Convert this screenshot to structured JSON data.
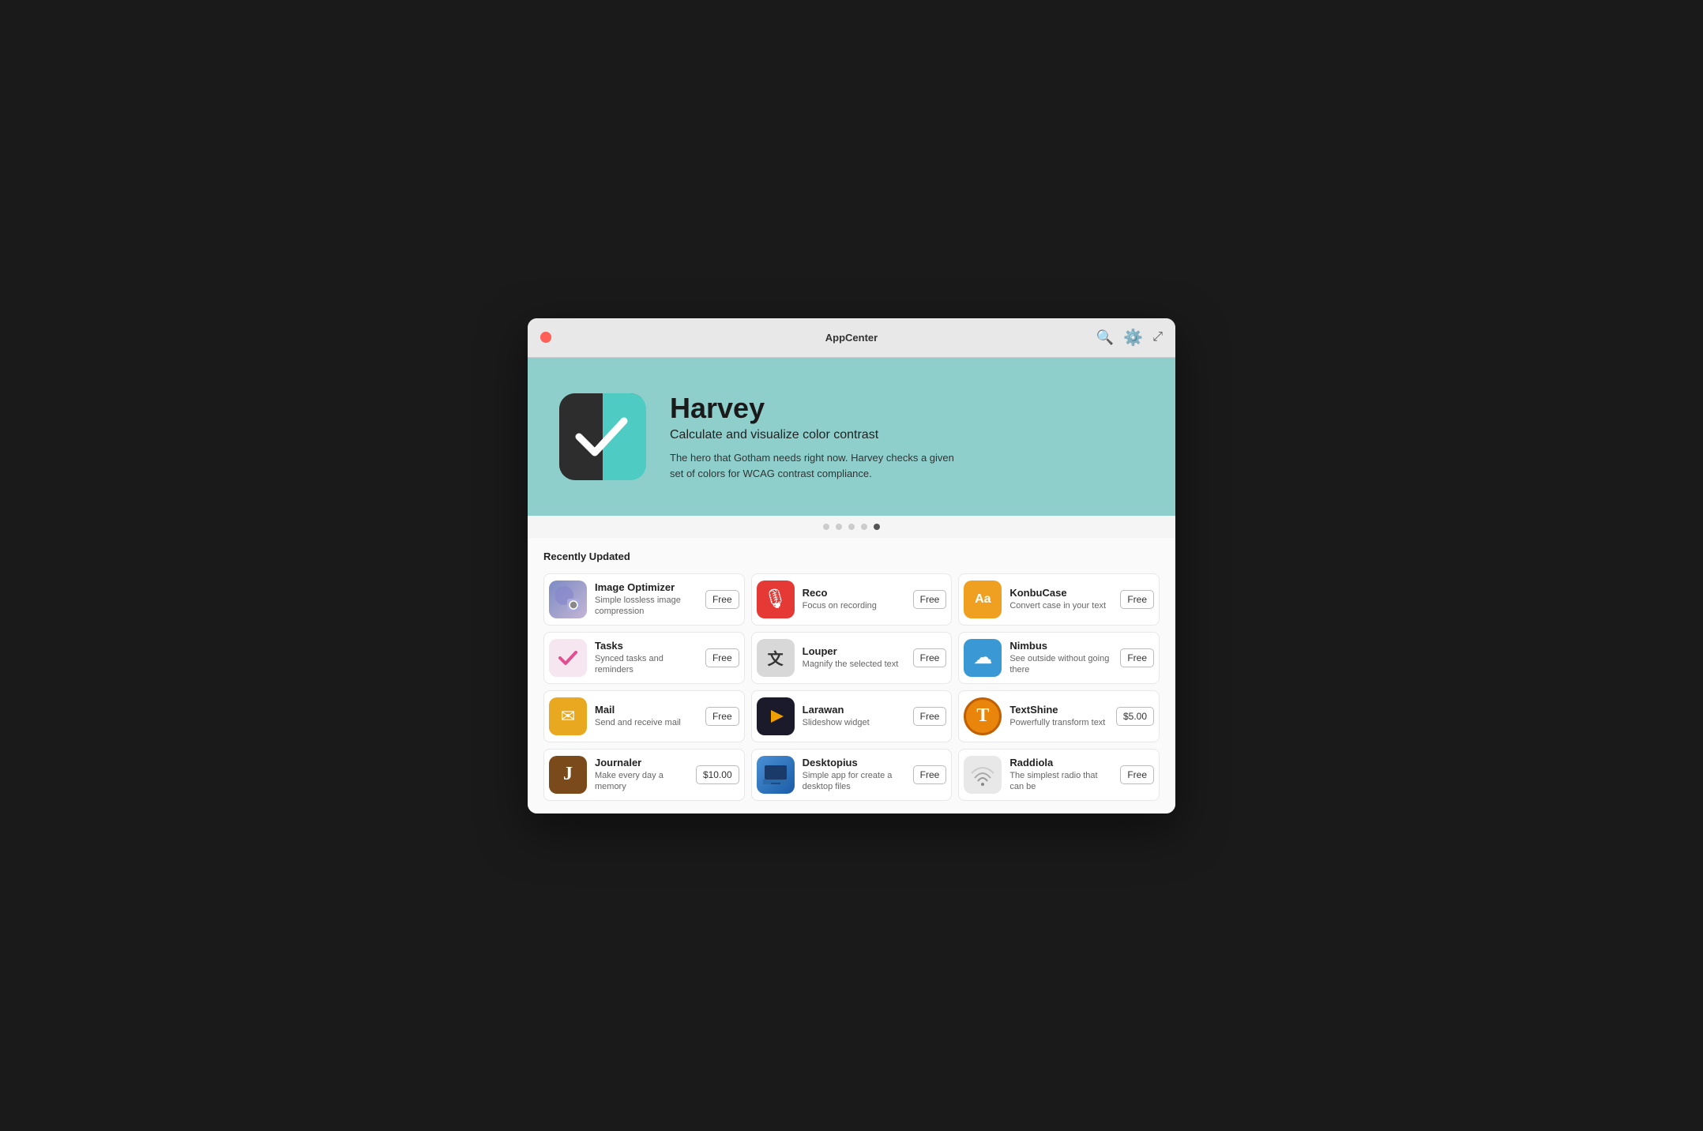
{
  "window": {
    "title": "AppCenter"
  },
  "titlebar": {
    "close_label": "×",
    "search_icon": "🔍",
    "badge_icon": "⚙",
    "expand_icon": "⤢"
  },
  "hero": {
    "title": "Harvey",
    "subtitle": "Calculate and visualize color contrast",
    "description": "The hero that Gotham needs right now. Harvey checks a given set of colors for WCAG contrast compliance."
  },
  "dots": [
    {
      "active": false
    },
    {
      "active": false
    },
    {
      "active": false
    },
    {
      "active": false
    },
    {
      "active": true
    }
  ],
  "section": {
    "title": "Recently Updated"
  },
  "apps": [
    {
      "id": "image-optimizer",
      "name": "Image Optimizer",
      "description": "Simple lossless image compression",
      "price": "Free",
      "icon": "🖼",
      "icon_class": "icon-image-optimizer"
    },
    {
      "id": "reco",
      "name": "Reco",
      "description": "Focus on recording",
      "price": "Free",
      "icon": "🎙",
      "icon_class": "icon-reco"
    },
    {
      "id": "konbucase",
      "name": "KonbuCase",
      "description": "Convert case in your text",
      "price": "Free",
      "icon": "Aa",
      "icon_class": "icon-konbucase"
    },
    {
      "id": "tasks",
      "name": "Tasks",
      "description": "Synced tasks and reminders",
      "price": "Free",
      "icon": "✓",
      "icon_class": "icon-tasks"
    },
    {
      "id": "louper",
      "name": "Louper",
      "description": "Magnify the selected text",
      "price": "Free",
      "icon": "文",
      "icon_class": "icon-louper"
    },
    {
      "id": "nimbus",
      "name": "Nimbus",
      "description": "See outside without going there",
      "price": "Free",
      "icon": "☁",
      "icon_class": "icon-nimbus"
    },
    {
      "id": "mail",
      "name": "Mail",
      "description": "Send and receive mail",
      "price": "Free",
      "icon": "✉",
      "icon_class": "icon-mail"
    },
    {
      "id": "larawan",
      "name": "Larawan",
      "description": "Slideshow widget",
      "price": "Free",
      "icon": "▶",
      "icon_class": "icon-larawan"
    },
    {
      "id": "textshine",
      "name": "TextShine",
      "description": "Powerfully transform text",
      "price": "$5.00",
      "icon": "T",
      "icon_class": "icon-textshine"
    },
    {
      "id": "journaler",
      "name": "Journaler",
      "description": "Make every day a memory",
      "price": "$10.00",
      "icon": "J",
      "icon_class": "icon-journaler"
    },
    {
      "id": "desktopius",
      "name": "Desktopius",
      "description": "Simple app for create a desktop files",
      "price": "Free",
      "icon": "🖥",
      "icon_class": "icon-desktopius"
    },
    {
      "id": "raddiola",
      "name": "Raddiola",
      "description": "The simplest radio that can be",
      "price": "Free",
      "icon": "📡",
      "icon_class": "icon-raddiola"
    }
  ]
}
